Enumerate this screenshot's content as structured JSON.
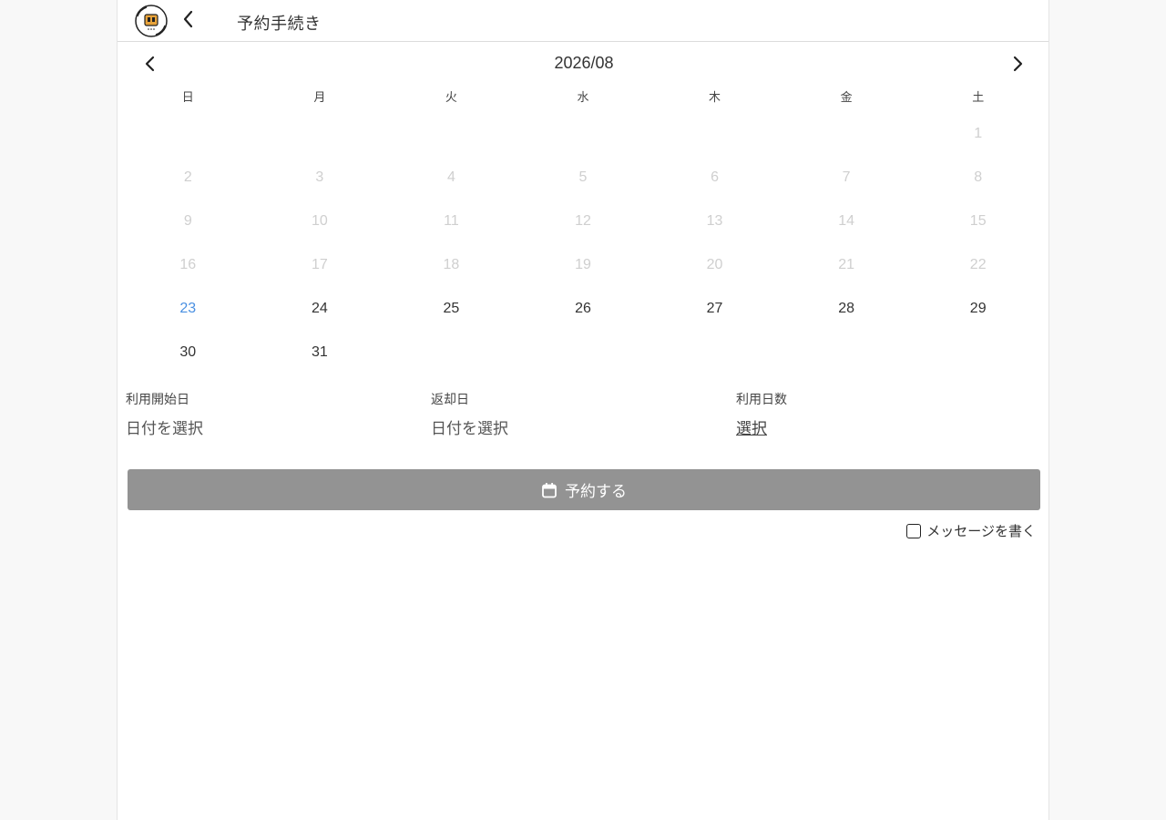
{
  "header": {
    "title": "予約手続き",
    "logo_icon": "shop-logo-icon",
    "back_icon": "chevron-left-icon"
  },
  "calendar": {
    "month_label": "2026/08",
    "prev_icon": "chevron-left-icon",
    "next_icon": "chevron-right-icon",
    "weekdays": [
      "日",
      "月",
      "火",
      "水",
      "木",
      "金",
      "土"
    ],
    "weeks": [
      [
        {
          "d": ""
        },
        {
          "d": ""
        },
        {
          "d": ""
        },
        {
          "d": ""
        },
        {
          "d": ""
        },
        {
          "d": ""
        },
        {
          "d": "1",
          "s": "disabled"
        }
      ],
      [
        {
          "d": "2",
          "s": "disabled"
        },
        {
          "d": "3",
          "s": "disabled"
        },
        {
          "d": "4",
          "s": "disabled"
        },
        {
          "d": "5",
          "s": "disabled"
        },
        {
          "d": "6",
          "s": "disabled"
        },
        {
          "d": "7",
          "s": "disabled"
        },
        {
          "d": "8",
          "s": "disabled"
        }
      ],
      [
        {
          "d": "9",
          "s": "disabled"
        },
        {
          "d": "10",
          "s": "disabled"
        },
        {
          "d": "11",
          "s": "disabled"
        },
        {
          "d": "12",
          "s": "disabled"
        },
        {
          "d": "13",
          "s": "disabled"
        },
        {
          "d": "14",
          "s": "disabled"
        },
        {
          "d": "15",
          "s": "disabled"
        }
      ],
      [
        {
          "d": "16",
          "s": "disabled"
        },
        {
          "d": "17",
          "s": "disabled"
        },
        {
          "d": "18",
          "s": "disabled"
        },
        {
          "d": "19",
          "s": "disabled"
        },
        {
          "d": "20",
          "s": "disabled"
        },
        {
          "d": "21",
          "s": "disabled"
        },
        {
          "d": "22",
          "s": "disabled"
        }
      ],
      [
        {
          "d": "23",
          "s": "today"
        },
        {
          "d": "24",
          "s": "avail"
        },
        {
          "d": "25",
          "s": "avail"
        },
        {
          "d": "26",
          "s": "avail"
        },
        {
          "d": "27",
          "s": "avail"
        },
        {
          "d": "28",
          "s": "avail"
        },
        {
          "d": "29",
          "s": "avail"
        }
      ],
      [
        {
          "d": "30",
          "s": "avail"
        },
        {
          "d": "31",
          "s": "avail"
        },
        {
          "d": ""
        },
        {
          "d": ""
        },
        {
          "d": ""
        },
        {
          "d": ""
        },
        {
          "d": ""
        }
      ]
    ],
    "colors": {
      "today": "#4a90e2",
      "disabled": "#cfcfcf",
      "available": "#333333"
    }
  },
  "booking": {
    "start_label": "利用開始日",
    "start_value": "日付を選択",
    "return_label": "返却日",
    "return_value": "日付を選択",
    "days_label": "利用日数",
    "days_value": "選択"
  },
  "reserve_button": {
    "label": "予約する",
    "icon": "calendar-icon",
    "bg_color": "#939393"
  },
  "message_checkbox": {
    "label": "メッセージを書く",
    "checked": false
  }
}
